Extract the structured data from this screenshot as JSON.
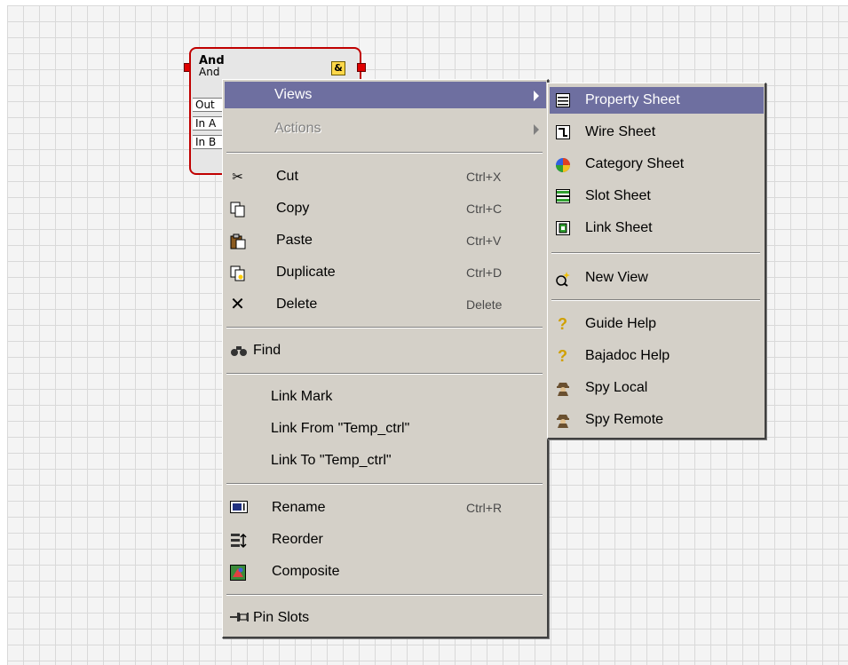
{
  "component": {
    "title": "And",
    "subtitle": "And",
    "icon_label": "&",
    "slots": [
      "Out",
      "In A",
      "In B"
    ]
  },
  "context_menu": {
    "items": [
      {
        "label": "Views",
        "submenu": true,
        "highlighted": true
      },
      {
        "label": "Actions",
        "submenu": true,
        "disabled": true
      },
      {
        "label": "Cut",
        "shortcut": "Ctrl+X",
        "icon": "scissors-icon"
      },
      {
        "label": "Copy",
        "shortcut": "Ctrl+C",
        "icon": "copy-icon"
      },
      {
        "label": "Paste",
        "shortcut": "Ctrl+V",
        "icon": "paste-icon"
      },
      {
        "label": "Duplicate",
        "shortcut": "Ctrl+D",
        "icon": "duplicate-icon"
      },
      {
        "label": "Delete",
        "shortcut": "Delete",
        "icon": "delete-x-icon"
      },
      {
        "label": "Find",
        "icon": "binoculars-icon"
      },
      {
        "label": "Link Mark"
      },
      {
        "label": "Link From \"Temp_ctrl\""
      },
      {
        "label": "Link To \"Temp_ctrl\""
      },
      {
        "label": "Rename",
        "shortcut": "Ctrl+R",
        "icon": "rename-icon"
      },
      {
        "label": "Reorder",
        "icon": "reorder-icon"
      },
      {
        "label": "Composite",
        "icon": "composite-icon"
      },
      {
        "label": "Pin Slots",
        "icon": "pin-icon"
      }
    ]
  },
  "views_submenu": {
    "items": [
      {
        "label": "Property Sheet",
        "highlighted": true,
        "icon": "property-sheet-icon"
      },
      {
        "label": "Wire Sheet",
        "icon": "wire-sheet-icon"
      },
      {
        "label": "Category Sheet",
        "icon": "category-sheet-icon"
      },
      {
        "label": "Slot Sheet",
        "icon": "slot-sheet-icon"
      },
      {
        "label": "Link Sheet",
        "icon": "link-sheet-icon"
      },
      {
        "label": "New View",
        "icon": "new-view-icon"
      },
      {
        "label": "Guide Help",
        "icon": "help-icon"
      },
      {
        "label": "Bajadoc Help",
        "icon": "help-icon"
      },
      {
        "label": "Spy Local",
        "icon": "spy-icon"
      },
      {
        "label": "Spy Remote",
        "icon": "spy-icon"
      }
    ]
  },
  "colors": {
    "highlight": "#6e6fa0",
    "menu_bg": "#d4d0c8",
    "component_border": "#c00000"
  }
}
